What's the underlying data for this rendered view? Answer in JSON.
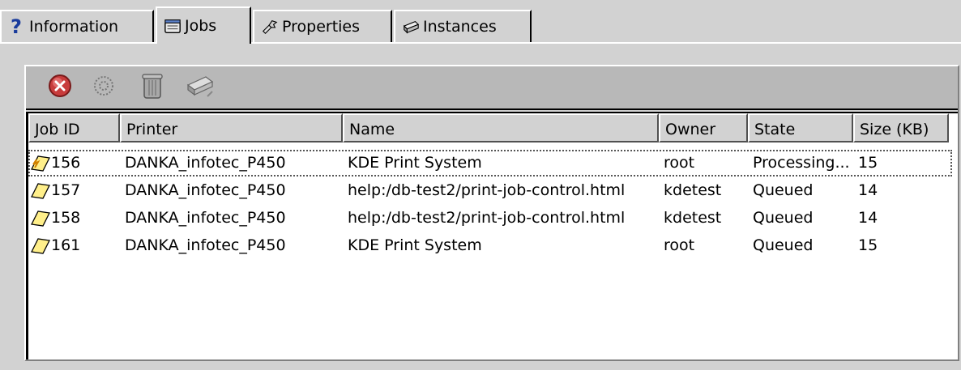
{
  "tabs": [
    {
      "label": "Information",
      "icon": "question-icon",
      "active": false
    },
    {
      "label": "Jobs",
      "icon": "jobs-icon",
      "active": true
    },
    {
      "label": "Properties",
      "icon": "properties-icon",
      "active": false
    },
    {
      "label": "Instances",
      "icon": "instances-icon",
      "active": false
    }
  ],
  "toolbar": {
    "buttons": [
      {
        "name": "cancel-job",
        "icon": "stop-icon"
      },
      {
        "name": "job-settings",
        "icon": "gear-icon"
      },
      {
        "name": "remove-job",
        "icon": "trash-icon"
      },
      {
        "name": "printer",
        "icon": "printer-icon"
      }
    ]
  },
  "table": {
    "columns": [
      "Job ID",
      "Printer",
      "Name",
      "Owner",
      "State",
      "Size (KB)"
    ],
    "rows": [
      {
        "job_id": "156",
        "printer": "DANKA_infotec_P450",
        "name": "KDE Print System",
        "owner": "root",
        "state": "Processing...",
        "size": "15",
        "icon": "printing-document-icon",
        "selected": true
      },
      {
        "job_id": "157",
        "printer": "DANKA_infotec_P450",
        "name": "help:/db-test2/print-job-control.html",
        "owner": "kdetest",
        "state": "Queued",
        "size": "14",
        "icon": "document-icon",
        "selected": false
      },
      {
        "job_id": "158",
        "printer": "DANKA_infotec_P450",
        "name": "help:/db-test2/print-job-control.html",
        "owner": "kdetest",
        "state": "Queued",
        "size": "14",
        "icon": "document-icon",
        "selected": false
      },
      {
        "job_id": "161",
        "printer": "DANKA_infotec_P450",
        "name": "KDE Print System",
        "owner": "root",
        "state": "Queued",
        "size": "15",
        "icon": "document-icon",
        "selected": false
      }
    ]
  },
  "colors": {
    "stop_red": "#c83c3c",
    "doc_yellow": "#ffef8a",
    "panel": "#d2d2d2"
  }
}
